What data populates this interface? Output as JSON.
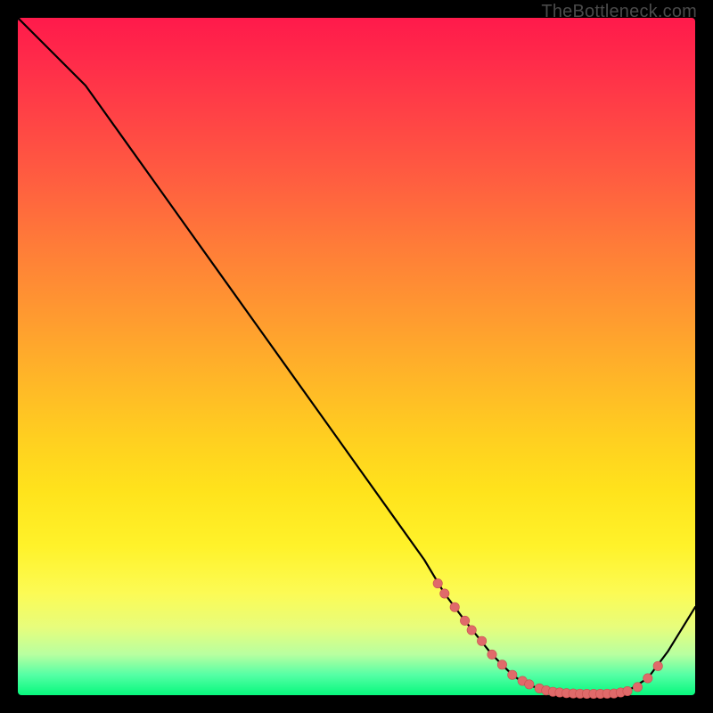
{
  "watermark": "TheBottleneck.com",
  "colors": {
    "page_bg": "#000000",
    "gradient_top": "#ff1a4b",
    "gradient_mid": "#ffe31c",
    "gradient_bottom": "#07f87d",
    "curve_stroke": "#000000",
    "markers_fill": "#e06a6a",
    "markers_stroke": "#c94f4f"
  },
  "chart_data": {
    "type": "line",
    "title": "",
    "xlabel": "",
    "ylabel": "",
    "xlim": [
      0,
      100
    ],
    "ylim": [
      0,
      100
    ],
    "grid": false,
    "legend": false,
    "series": [
      {
        "name": "bottleneck-curve",
        "x": [
          0,
          5,
          10,
          15,
          20,
          25,
          30,
          35,
          40,
          45,
          50,
          55,
          60,
          63,
          66,
          70,
          73,
          75,
          78,
          80,
          82,
          84,
          86,
          88,
          90,
          93,
          96,
          100
        ],
        "y": [
          100,
          95,
          90,
          83,
          76,
          69,
          62,
          55,
          48,
          41,
          34,
          27,
          20,
          15,
          11,
          6,
          3,
          1.6,
          0.7,
          0.4,
          0.25,
          0.2,
          0.2,
          0.25,
          0.6,
          2.5,
          6.5,
          13
        ]
      }
    ],
    "markers": {
      "name": "curve-dots",
      "x": [
        62,
        63,
        64.5,
        66,
        67,
        68.5,
        70,
        71.5,
        73,
        74.5,
        75.5,
        77,
        78,
        79,
        80,
        81,
        82,
        83,
        84,
        85,
        86,
        87,
        88,
        89,
        90,
        91.5,
        93,
        94.5
      ],
      "y": [
        16.5,
        15,
        13,
        11,
        9.6,
        8,
        6,
        4.5,
        3,
        2.1,
        1.6,
        1.0,
        0.7,
        0.5,
        0.4,
        0.3,
        0.25,
        0.22,
        0.2,
        0.2,
        0.2,
        0.22,
        0.25,
        0.4,
        0.6,
        1.2,
        2.5,
        4.3
      ]
    }
  }
}
